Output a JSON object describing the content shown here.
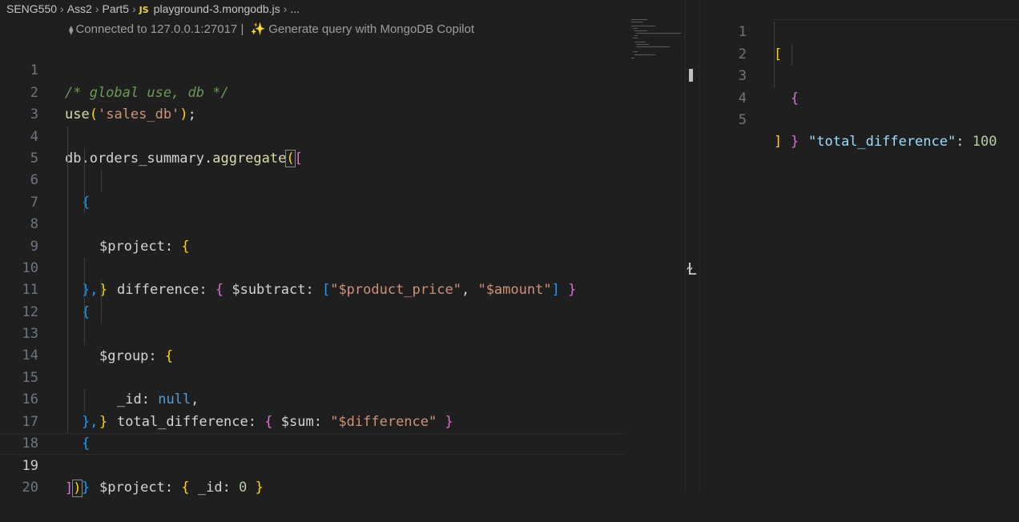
{
  "breadcrumb": {
    "items": [
      "SENG550",
      "Ass2",
      "Part5"
    ],
    "file_badge": "JS",
    "file_name": "playground-3.mongodb.js",
    "more": "..."
  },
  "codelens": {
    "connected": "Connected to 127.0.0.1:27017 |",
    "sparkle": "✨",
    "generate": "Generate query with MongoDB Copilot"
  },
  "editor": {
    "line_numbers": [
      "1",
      "2",
      "3",
      "4",
      "5",
      "6",
      "7",
      "8",
      "9",
      "10",
      "11",
      "12",
      "13",
      "14",
      "15",
      "16",
      "17",
      "18",
      "19",
      "20"
    ],
    "active_line": "19",
    "lines": {
      "l1": "/* global use, db */",
      "l2_func": "use",
      "l2_paren_open": "(",
      "l2_str": "'sales_db'",
      "l2_paren_close": ")",
      "l2_semi": ";",
      "l4_obj": "db.orders_summary.",
      "l4_func": "aggregate",
      "l4_paren": "(",
      "l4_bracket": "[",
      "brace_open": "{",
      "brace_close": "}",
      "brace_close_comma": "},",
      "l6_key": "$project",
      "colon": ": ",
      "l7_key": "difference",
      "l7_op": "$subtract",
      "l7_arr_open": "[",
      "l7_s1": "\"$product_price\"",
      "comma": ", ",
      "l7_s2": "\"$amount\"",
      "l7_arr_close": "]",
      "l11_key": "$group",
      "l12_key": "_id",
      "l12_val": "null",
      "l12_comma": ",",
      "l13_key": "total_difference",
      "l13_op": "$sum",
      "l13_str": "\"$difference\"",
      "l17_key": "$project",
      "l17_inner_key": "_id",
      "l17_val": "0",
      "l19_bracket": "]",
      "l19_paren": ")"
    }
  },
  "output": {
    "line_numbers": [
      "1",
      "2",
      "3",
      "4",
      "5"
    ],
    "open_bracket": "[",
    "open_brace": "{",
    "key": "\"total_difference\"",
    "colon": ": ",
    "value": "100",
    "close_brace": "}",
    "close_bracket": "]"
  },
  "colors": {
    "background": "#1f1f1f",
    "comment": "#6a9955",
    "function": "#dcdcaa",
    "string": "#ce9178",
    "variable": "#9cdcfe",
    "keyword": "#569cd6",
    "number": "#b5cea8",
    "bracket_level1": "#ffd700",
    "bracket_level2": "#da70d6",
    "bracket_level3": "#179fff"
  }
}
